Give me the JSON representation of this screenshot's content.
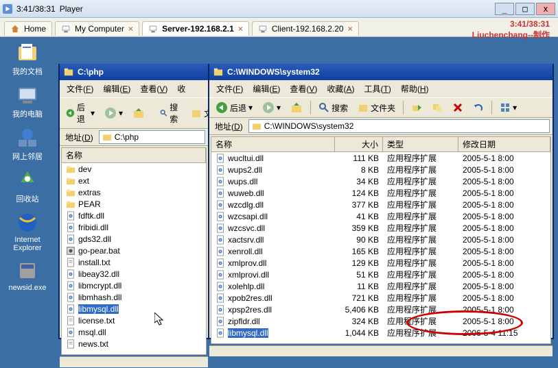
{
  "titlebar": {
    "time": "3:41/38:31",
    "appname": "Player"
  },
  "win_controls": {
    "min": "_",
    "max": "□",
    "close": "x"
  },
  "tabs": [
    {
      "label": "Home",
      "active": false
    },
    {
      "label": "My Computer",
      "active": false,
      "closable": true
    },
    {
      "label": "Server-192.168.2.1",
      "active": true,
      "closable": true
    },
    {
      "label": "Client-192.168.2.20",
      "active": false,
      "closable": true
    }
  ],
  "watermark": {
    "line1": "3:41/38:31",
    "line2": "Liuchenchang--制作"
  },
  "desktop_icons": [
    {
      "name": "我的文档",
      "icon": "docs"
    },
    {
      "name": "我的电脑",
      "icon": "computer"
    },
    {
      "name": "网上邻居",
      "icon": "network"
    },
    {
      "name": "回收站",
      "icon": "recycle"
    },
    {
      "name": "Internet Explorer",
      "icon": "ie"
    },
    {
      "name": "newsid.exe",
      "icon": "exe"
    }
  ],
  "menus": {
    "file": "文件",
    "file_a": "F",
    "edit": "编辑",
    "edit_a": "E",
    "view": "查看",
    "view_a": "V",
    "fav": "收藏",
    "fav_a": "A",
    "tools": "工具",
    "tools_a": "T",
    "help": "帮助",
    "help_a": "H",
    "fav_short": "收"
  },
  "toolbar": {
    "back": "后退",
    "search": "搜索",
    "folders": "文件夹"
  },
  "addressbar": {
    "label": "地址",
    "label_a": "D"
  },
  "left_window": {
    "title": "C:\\php",
    "path": "C:\\php",
    "columns": {
      "name": "名称"
    },
    "files": [
      {
        "name": "dev",
        "type": "folder"
      },
      {
        "name": "ext",
        "type": "folder"
      },
      {
        "name": "extras",
        "type": "folder"
      },
      {
        "name": "PEAR",
        "type": "folder"
      },
      {
        "name": "fdftk.dll",
        "type": "dll"
      },
      {
        "name": "fribidi.dll",
        "type": "dll"
      },
      {
        "name": "gds32.dll",
        "type": "dll"
      },
      {
        "name": "go-pear.bat",
        "type": "bat"
      },
      {
        "name": "install.txt",
        "type": "txt"
      },
      {
        "name": "libeay32.dll",
        "type": "dll"
      },
      {
        "name": "libmcrypt.dll",
        "type": "dll"
      },
      {
        "name": "libmhash.dll",
        "type": "dll"
      },
      {
        "name": "libmysql.dll",
        "type": "dll",
        "selected": true
      },
      {
        "name": "license.txt",
        "type": "txt"
      },
      {
        "name": "msql.dll",
        "type": "dll"
      },
      {
        "name": "news.txt",
        "type": "txt"
      }
    ]
  },
  "right_window": {
    "title": "C:\\WINDOWS\\system32",
    "path": "C:\\WINDOWS\\system32",
    "columns": {
      "name": "名称",
      "size": "大小",
      "type": "类型",
      "date": "修改日期"
    },
    "files": [
      {
        "name": "wucltui.dll",
        "size": "111 KB",
        "type": "应用程序扩展",
        "date": "2005-5-1 8:00"
      },
      {
        "name": "wups2.dll",
        "size": "8 KB",
        "type": "应用程序扩展",
        "date": "2005-5-1 8:00"
      },
      {
        "name": "wups.dll",
        "size": "34 KB",
        "type": "应用程序扩展",
        "date": "2005-5-1 8:00"
      },
      {
        "name": "wuweb.dll",
        "size": "124 KB",
        "type": "应用程序扩展",
        "date": "2005-5-1 8:00"
      },
      {
        "name": "wzcdlg.dll",
        "size": "377 KB",
        "type": "应用程序扩展",
        "date": "2005-5-1 8:00"
      },
      {
        "name": "wzcsapi.dll",
        "size": "41 KB",
        "type": "应用程序扩展",
        "date": "2005-5-1 8:00"
      },
      {
        "name": "wzcsvc.dll",
        "size": "359 KB",
        "type": "应用程序扩展",
        "date": "2005-5-1 8:00"
      },
      {
        "name": "xactsrv.dll",
        "size": "90 KB",
        "type": "应用程序扩展",
        "date": "2005-5-1 8:00"
      },
      {
        "name": "xenroll.dll",
        "size": "165 KB",
        "type": "应用程序扩展",
        "date": "2005-5-1 8:00"
      },
      {
        "name": "xmlprov.dll",
        "size": "129 KB",
        "type": "应用程序扩展",
        "date": "2005-5-1 8:00"
      },
      {
        "name": "xmlprovi.dll",
        "size": "51 KB",
        "type": "应用程序扩展",
        "date": "2005-5-1 8:00"
      },
      {
        "name": "xolehlp.dll",
        "size": "11 KB",
        "type": "应用程序扩展",
        "date": "2005-5-1 8:00"
      },
      {
        "name": "xpob2res.dll",
        "size": "721 KB",
        "type": "应用程序扩展",
        "date": "2005-5-1 8:00"
      },
      {
        "name": "xpsp2res.dll",
        "size": "5,406 KB",
        "type": "应用程序扩展",
        "date": "2005-5-1 8:00"
      },
      {
        "name": "zipfldr.dll",
        "size": "324 KB",
        "type": "应用程序扩展",
        "date": "2005-5-1 8:00"
      },
      {
        "name": "libmysql.dll",
        "size": "1,044 KB",
        "type": "应用程序扩展",
        "date": "2006-5-4 11:15",
        "selected": true
      }
    ]
  }
}
